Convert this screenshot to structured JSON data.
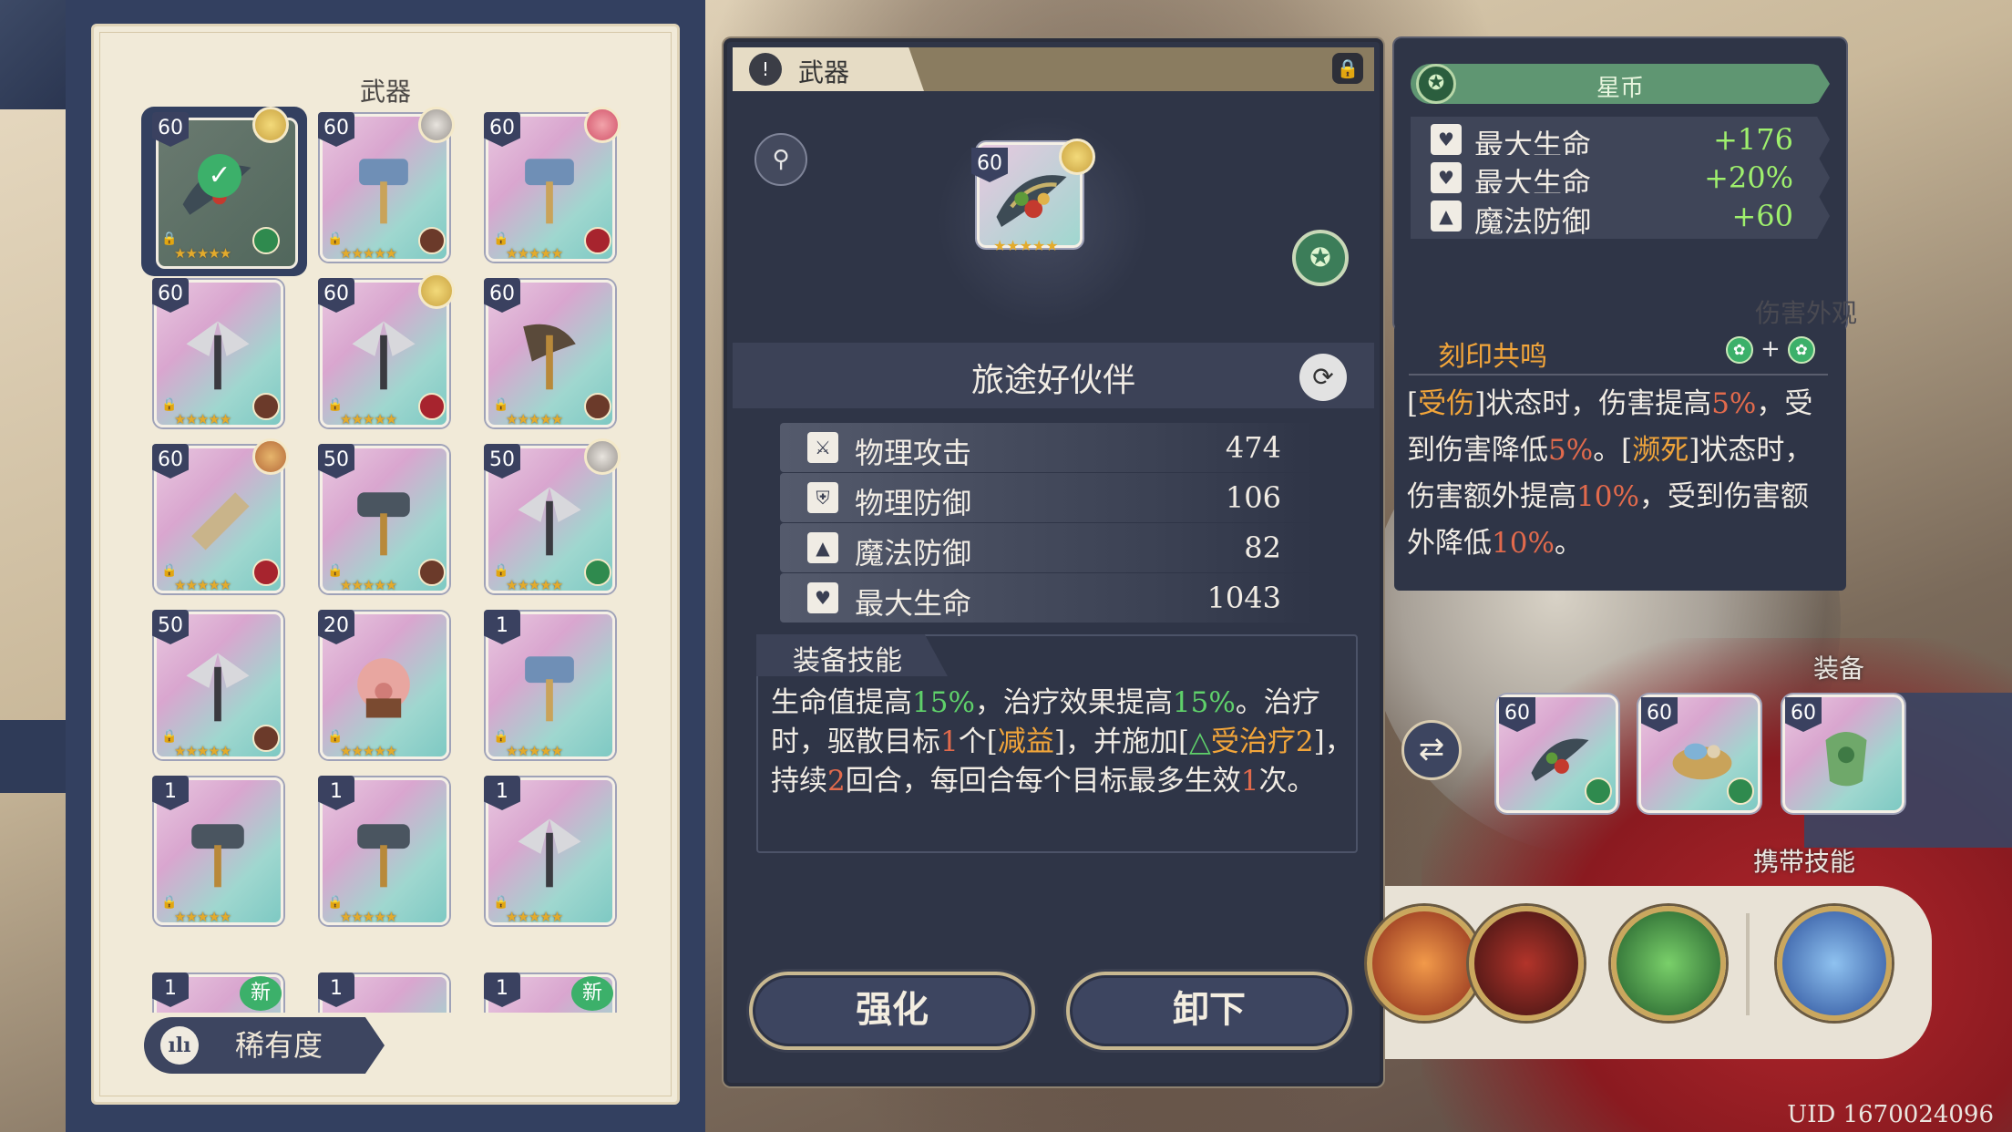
{
  "weapon_list": {
    "title": "武器",
    "cards": [
      {
        "level": "60",
        "stars": "★★★★★",
        "selected": true,
        "badge": "green",
        "avatar": "gold",
        "weapon": "fish-staff"
      },
      {
        "level": "60",
        "stars": "★★★★★",
        "badge": "brown",
        "avatar": "gray",
        "weapon": "hammer"
      },
      {
        "level": "60",
        "stars": "★★★★★",
        "badge": "red",
        "avatar": "pink",
        "weapon": "hammer"
      },
      {
        "level": "60",
        "stars": "★★★★★",
        "badge": "brown",
        "weapon": "axe"
      },
      {
        "level": "60",
        "stars": "★★★★★",
        "badge": "red",
        "avatar": "gold",
        "weapon": "axe"
      },
      {
        "level": "60",
        "stars": "★★★★★",
        "badge": "brown",
        "weapon": "axe-dark"
      },
      {
        "level": "60",
        "stars": "★★★★★",
        "badge": "red",
        "avatar": "orange",
        "weapon": "cleaver"
      },
      {
        "level": "50",
        "stars": "★★★★★",
        "badge": "brown",
        "weapon": "hammer-gold"
      },
      {
        "level": "50",
        "stars": "★★★★★",
        "badge": "green",
        "avatar": "gray",
        "weapon": "axe"
      },
      {
        "level": "50",
        "stars": "★★★★★",
        "badge": "brown",
        "weapon": "axe"
      },
      {
        "level": "20",
        "stars": "★★★★★",
        "weapon": "pig"
      },
      {
        "level": "1",
        "stars": "★★★★★",
        "weapon": "hammer"
      },
      {
        "level": "1",
        "stars": "★★★★★",
        "weapon": "hammer-gold"
      },
      {
        "level": "1",
        "stars": "★★★★★",
        "weapon": "hammer-gold"
      },
      {
        "level": "1",
        "stars": "★★★★★",
        "weapon": "axe"
      }
    ],
    "partial_row": [
      {
        "level": "1",
        "new": "新"
      },
      {
        "level": "1",
        "new": ""
      },
      {
        "level": "1",
        "new": "新"
      }
    ],
    "sort_button": "稀有度"
  },
  "detail": {
    "tab_title": "武器",
    "level": "60",
    "name": "旅途好伙伴",
    "stats": [
      {
        "icon": "sword-icon",
        "label": "物理攻击",
        "value": "474"
      },
      {
        "icon": "shield-icon",
        "label": "物理防御",
        "value": "106"
      },
      {
        "icon": "wizard-hat-icon",
        "label": "魔法防御",
        "value": "82"
      },
      {
        "icon": "heart-icon",
        "label": "最大生命",
        "value": "1043"
      }
    ],
    "skill_title": "装备技能",
    "skill_parts": [
      {
        "t": "生命值提高",
        "c": ""
      },
      {
        "t": "15%",
        "c": "g"
      },
      {
        "t": "，治疗效果提高",
        "c": ""
      },
      {
        "t": "15%",
        "c": "g"
      },
      {
        "t": "。治疗时，驱散目标",
        "c": ""
      },
      {
        "t": "1",
        "c": "r"
      },
      {
        "t": "个[",
        "c": ""
      },
      {
        "t": "减益",
        "c": "o"
      },
      {
        "t": "]，并施加[",
        "c": ""
      },
      {
        "t": "△",
        "c": "g"
      },
      {
        "t": "受治疗2",
        "c": "o"
      },
      {
        "t": "]，持续",
        "c": ""
      },
      {
        "t": "2",
        "c": "r"
      },
      {
        "t": "回合，每回合每个目标最多生效",
        "c": ""
      },
      {
        "t": "1",
        "c": "r"
      },
      {
        "t": "次。",
        "c": ""
      }
    ],
    "enhance_button": "强化",
    "unequip_button": "卸下"
  },
  "bonus": {
    "currency_label": "星币",
    "rows": [
      {
        "label": "最大生命",
        "value": "+176",
        "icon": "heart-icon"
      },
      {
        "label": "最大生命",
        "value": "+20%",
        "icon": "heart-icon"
      },
      {
        "label": "魔法防御",
        "value": "+60",
        "icon": "wizard-hat-icon"
      }
    ]
  },
  "imprint": {
    "title": "刻印共鸣",
    "plus": "+",
    "text_parts": [
      {
        "t": "[",
        "c": ""
      },
      {
        "t": "受伤",
        "c": "o"
      },
      {
        "t": "]状态时，伤害提高",
        "c": ""
      },
      {
        "t": "5%",
        "c": "r"
      },
      {
        "t": "，受到伤害降低",
        "c": ""
      },
      {
        "t": "5%",
        "c": "r"
      },
      {
        "t": "。[",
        "c": ""
      },
      {
        "t": "濒死",
        "c": "o"
      },
      {
        "t": "]状态时，伤害额外提高",
        "c": ""
      },
      {
        "t": "10%",
        "c": "r"
      },
      {
        "t": "，受到伤害额外降低",
        "c": ""
      },
      {
        "t": "10%",
        "c": "r"
      },
      {
        "t": "。",
        "c": ""
      }
    ]
  },
  "side": {
    "appearance_label": "伤害外观",
    "equipment_label": "装备",
    "carried_skills_label": "携带技能",
    "equipment": [
      {
        "level": "60"
      },
      {
        "level": "60"
      },
      {
        "level": "60"
      }
    ]
  },
  "uid": "UID 1670024096",
  "colors": {
    "highlight_green": "#5fd16a",
    "highlight_red": "#e26a4c",
    "highlight_orange": "#f2a53a",
    "bonus_value": "#9ff06d",
    "panel": "#2f3547"
  }
}
